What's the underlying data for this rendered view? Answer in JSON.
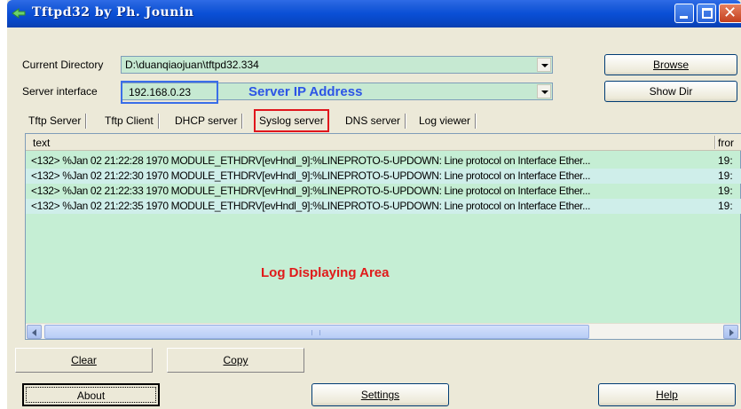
{
  "window": {
    "title": "Tftpd32 by Ph. Jounin",
    "close_glyph": "✕"
  },
  "current_directory": {
    "label": "Current Directory",
    "value": "D:\\duanqiaojuan\\tftpd32.334"
  },
  "server_interface": {
    "label": "Server interface",
    "value": "192.168.0.23",
    "annotation": "Server IP Address",
    "annotation_color": "#2c55e6"
  },
  "buttons": {
    "browse": "Browse",
    "show_dir": "Show Dir",
    "clear": "Clear",
    "copy": "Copy",
    "about": "About",
    "settings": "Settings",
    "help": "Help"
  },
  "tabs": [
    "Tftp Server",
    "Tftp Client",
    "DHCP server",
    "Syslog server",
    "DNS server",
    "Log viewer"
  ],
  "active_tab": "Syslog server",
  "highlight_color": "#e0161c",
  "log": {
    "columns": {
      "text": "text",
      "from": "fror"
    },
    "rows": [
      {
        "text": "<132> %Jan 02 21:22:28 1970 MODULE_ETHDRV[evHndl_9]:%LINEPROTO-5-UPDOWN: Line protocol on Interface Ether...",
        "from": "19:"
      },
      {
        "text": "<132> %Jan 02 21:22:30 1970 MODULE_ETHDRV[evHndl_9]:%LINEPROTO-5-UPDOWN: Line protocol on Interface Ether...",
        "from": "19:"
      },
      {
        "text": "<132> %Jan 02 21:22:33 1970 MODULE_ETHDRV[evHndl_9]:%LINEPROTO-5-UPDOWN: Line protocol on Interface Ether...",
        "from": "19:"
      },
      {
        "text": "<132> %Jan 02 21:22:35 1970 MODULE_ETHDRV[evHndl_9]:%LINEPROTO-5-UPDOWN: Line protocol on Interface Ether...",
        "from": "19:"
      }
    ],
    "annotation": "Log Displaying Area",
    "annotation_color": "#e01a1a"
  },
  "icons": {
    "app": "tftpd-app-icon",
    "minimize": "minimize-icon",
    "maximize": "maximize-icon",
    "close": "close-icon",
    "dropdown": "chevron-down-icon",
    "scroll_left": "arrow-left-icon",
    "scroll_right": "arrow-right-icon"
  }
}
